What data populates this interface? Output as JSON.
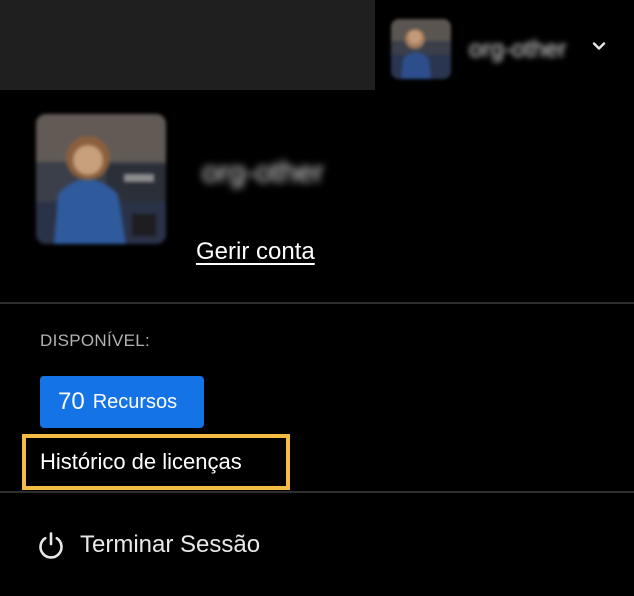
{
  "header": {
    "account_name": "org-other",
    "chevron_icon": "chevron-down-icon"
  },
  "profile": {
    "account_name": "org-other",
    "manage_account_label": "Gerir conta"
  },
  "credits": {
    "available_label": "DISPONÍVEL:",
    "count": "70",
    "unit_label": "Recursos",
    "button_color": "#1473e6"
  },
  "menu": {
    "license_history_label": "Histórico de licenças",
    "highlight_color": "#f4bc44",
    "sign_out_label": "Terminar Sessão",
    "sign_out_icon": "power-icon"
  }
}
